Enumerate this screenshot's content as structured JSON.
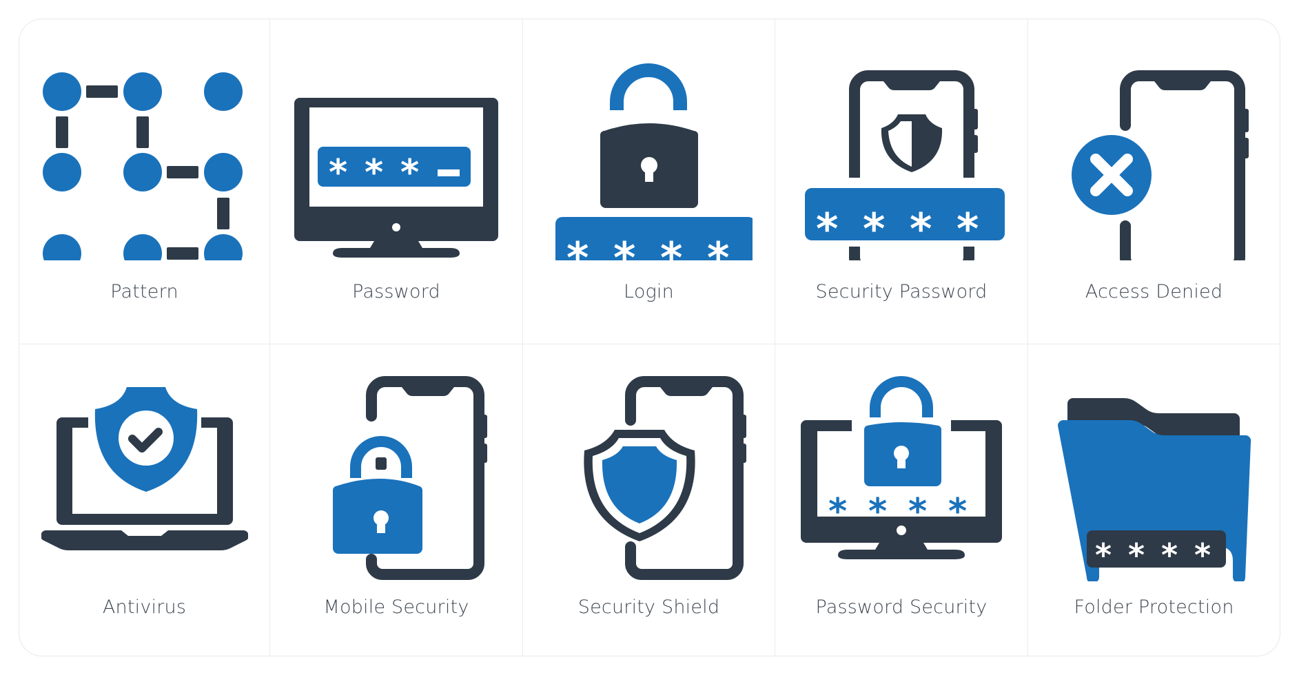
{
  "colors": {
    "accent": "#1a72bb",
    "dark": "#2e3a47",
    "label": "#3f4852",
    "border": "#e6e8ea"
  },
  "tiles": [
    {
      "label": "Pattern",
      "icon": "pattern-lock-icon"
    },
    {
      "label": "Password",
      "icon": "monitor-password-icon"
    },
    {
      "label": "Login",
      "icon": "padlock-password-icon"
    },
    {
      "label": "Security Password",
      "icon": "phone-shield-password-icon"
    },
    {
      "label": "Access Denied",
      "icon": "phone-denied-icon"
    },
    {
      "label": "Antivirus",
      "icon": "laptop-shield-check-icon"
    },
    {
      "label": "Mobile Security",
      "icon": "phone-padlock-icon"
    },
    {
      "label": "Security Shield",
      "icon": "phone-shield-icon"
    },
    {
      "label": "Password Security",
      "icon": "monitor-padlock-password-icon"
    },
    {
      "label": "Folder Protection",
      "icon": "folder-password-icon"
    }
  ],
  "password_masks": {
    "password": "***_",
    "login": "****",
    "security_password": "****",
    "password_security": "****",
    "folder_protection": "****"
  }
}
